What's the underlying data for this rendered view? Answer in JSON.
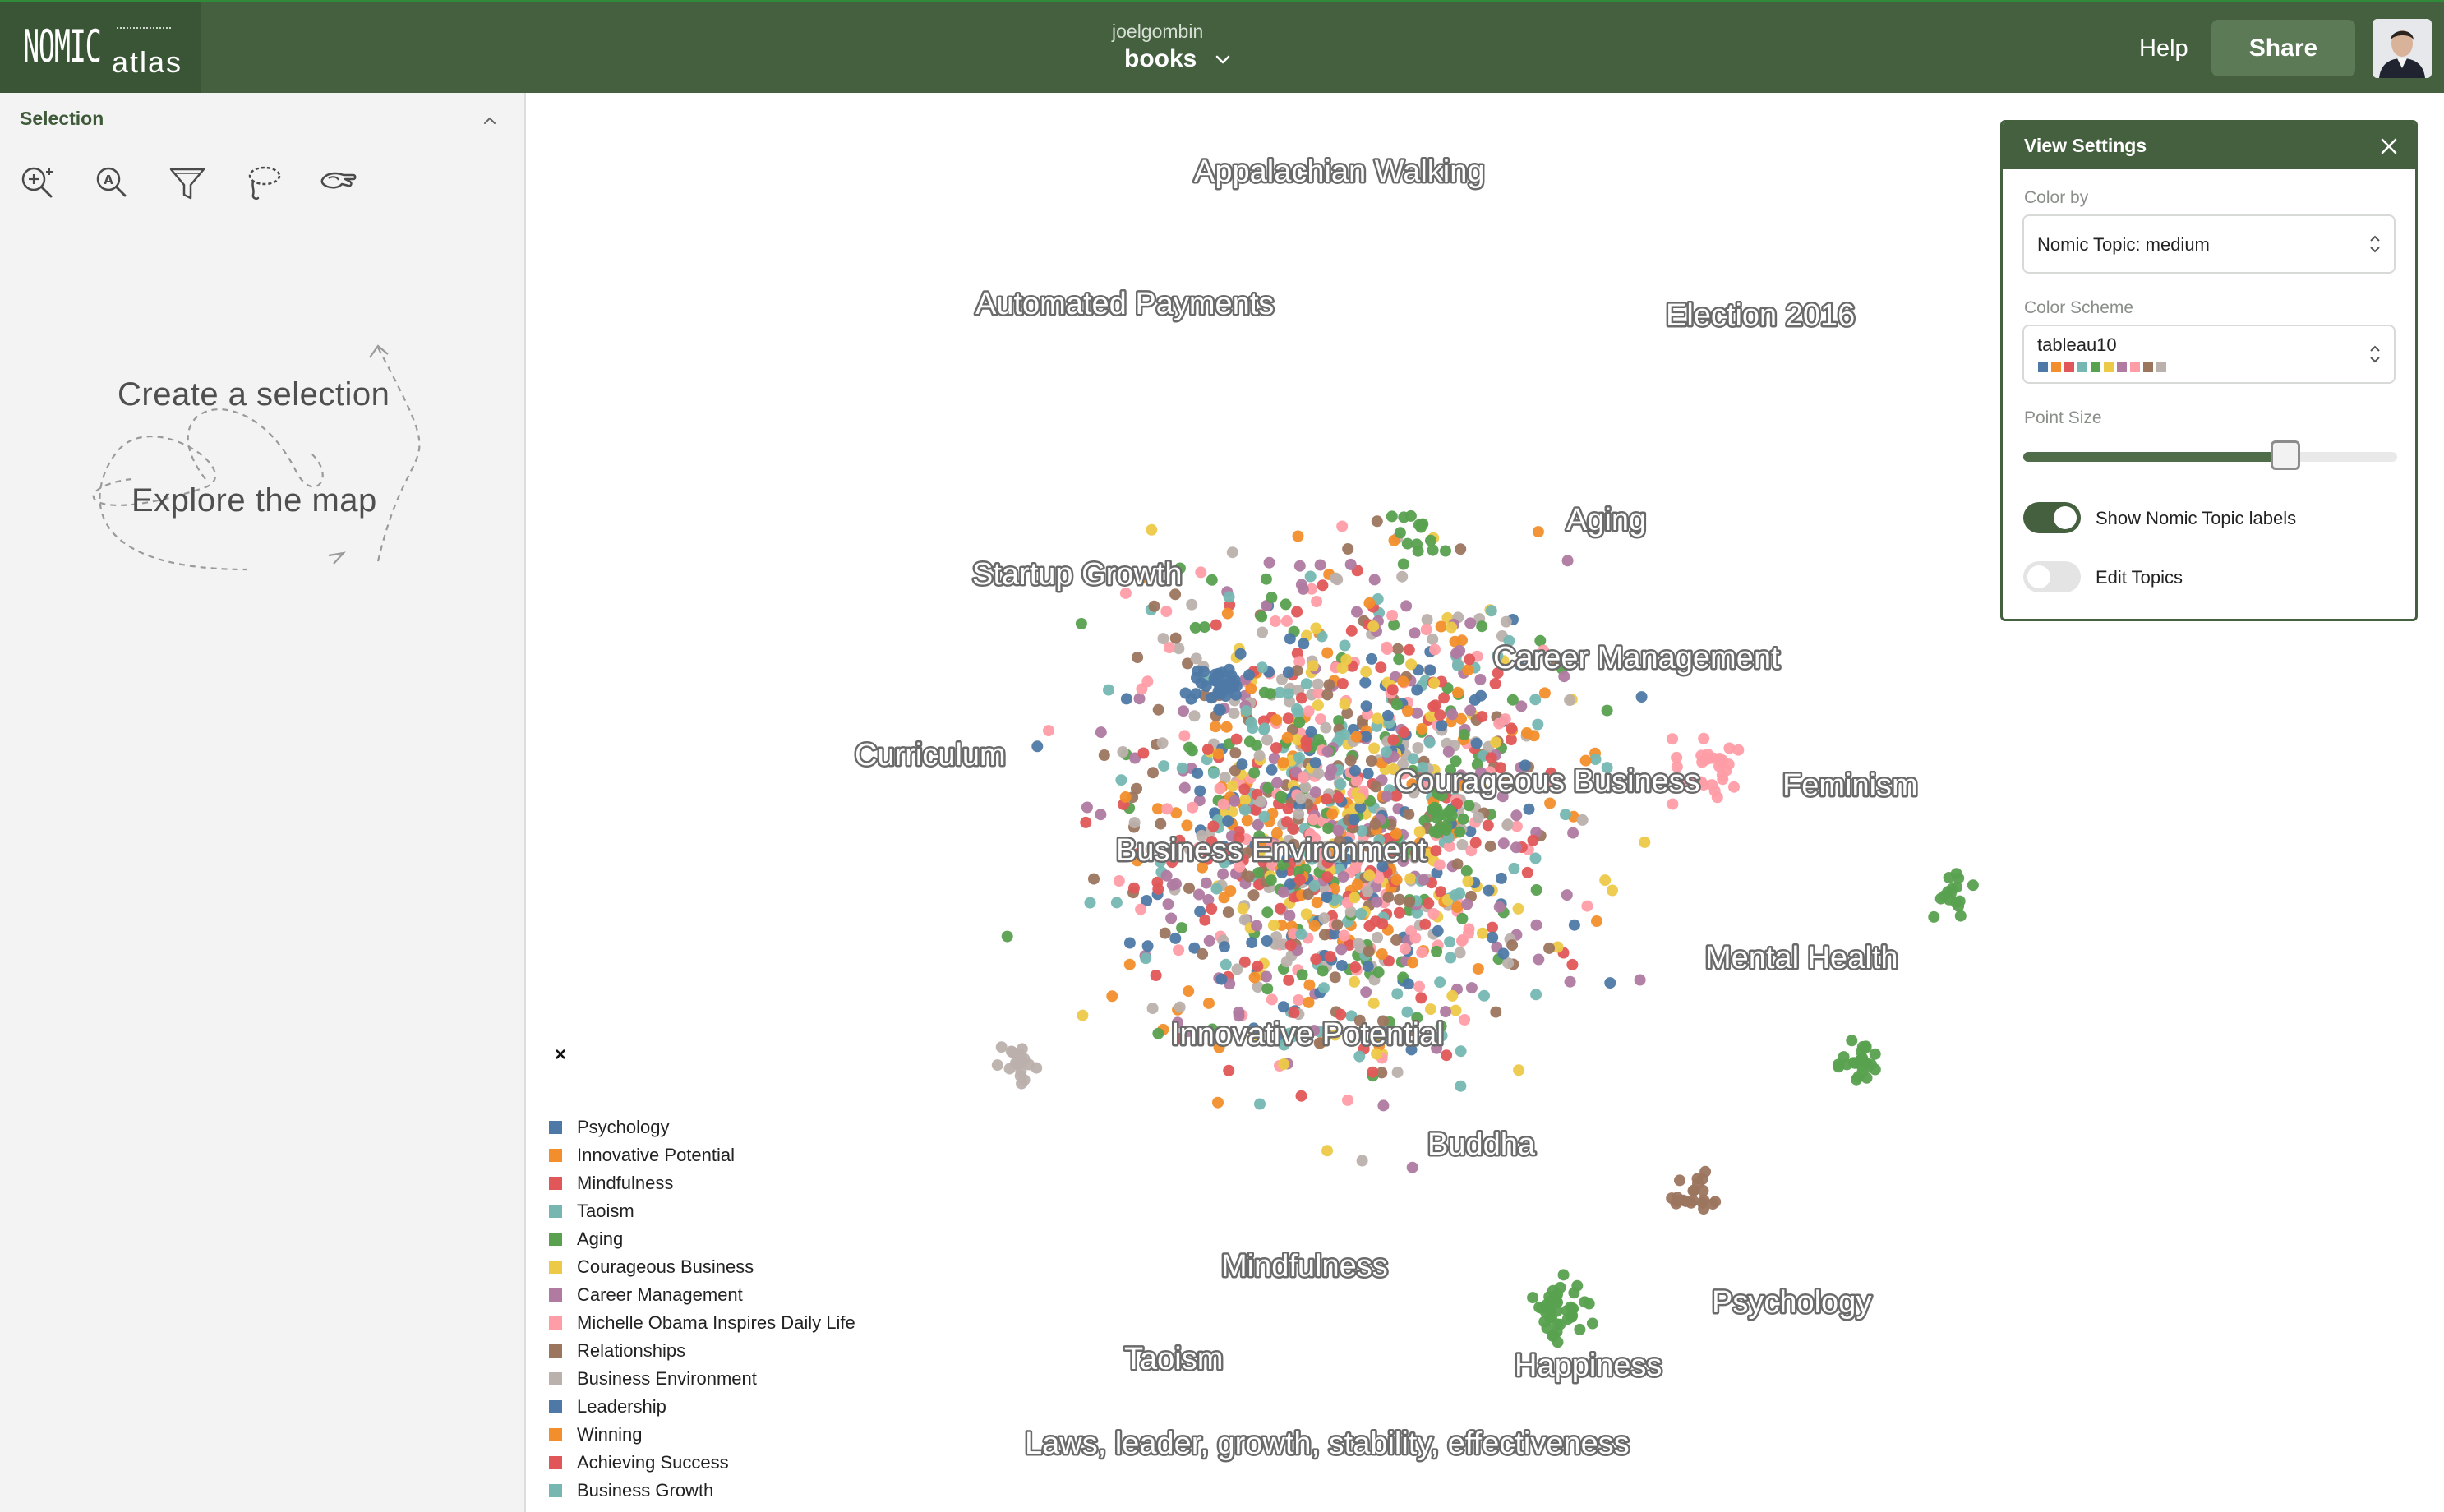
{
  "header": {
    "logo_nomic": "NOMIC",
    "logo_atlas": "atlas",
    "user": "joelgombin",
    "project": "books",
    "help_label": "Help",
    "share_label": "Share"
  },
  "sidebar": {
    "title": "Selection",
    "tools": [
      "zoom-in-icon",
      "search-icon",
      "filter-icon",
      "lasso-icon",
      "hand-pointer-icon"
    ],
    "hint_create": "Create a selection",
    "hint_explore": "Explore the map"
  },
  "legend": {
    "close_label": "×",
    "items": [
      {
        "label": "Psychology",
        "color": "#4e79a7"
      },
      {
        "label": "Innovative Potential",
        "color": "#f28e2b"
      },
      {
        "label": "Mindfulness",
        "color": "#e15759"
      },
      {
        "label": "Taoism",
        "color": "#76b7b2"
      },
      {
        "label": "Aging",
        "color": "#59a14f"
      },
      {
        "label": "Courageous Business",
        "color": "#edc948"
      },
      {
        "label": "Career Management",
        "color": "#b07aa1"
      },
      {
        "label": "Michelle Obama Inspires Daily Life",
        "color": "#ff9da7"
      },
      {
        "label": "Relationships",
        "color": "#9c755f"
      },
      {
        "label": "Business Environment",
        "color": "#bab0ac"
      },
      {
        "label": "Leadership",
        "color": "#4e79a7"
      },
      {
        "label": "Winning",
        "color": "#f28e2b"
      },
      {
        "label": "Achieving Success",
        "color": "#e15759"
      },
      {
        "label": "Business Growth",
        "color": "#76b7b2"
      }
    ]
  },
  "topic_labels": [
    "Appalachian Walking",
    "Automated Payments",
    "Election 2016",
    "Aging",
    "Startup Growth",
    "Career Management",
    "Curriculum",
    "Courageous Business",
    "Feminism",
    "Business Environment",
    "Mental Health",
    "Innovative Potential",
    "Buddha",
    "Mindfulness",
    "Psychology",
    "Taoism",
    "Happiness",
    "Laws, leader, growth, stability, effectiveness"
  ],
  "view_settings": {
    "title": "View Settings",
    "color_by_label": "Color by",
    "color_by_value": "Nomic Topic: medium",
    "color_scheme_label": "Color Scheme",
    "color_scheme_value": "tableau10",
    "scheme_colors": [
      "#4e79a7",
      "#f28e2b",
      "#e15759",
      "#76b7b2",
      "#59a14f",
      "#edc948",
      "#b07aa1",
      "#ff9da7",
      "#9c755f",
      "#bab0ac"
    ],
    "point_size_label": "Point Size",
    "point_size_fraction": 0.7,
    "show_labels_label": "Show Nomic Topic labels",
    "show_labels_on": true,
    "edit_topics_label": "Edit Topics",
    "edit_topics_on": false
  },
  "colors": {
    "brand": "#44603f",
    "brand_dark": "#395535",
    "accent": "#5c7a56"
  }
}
